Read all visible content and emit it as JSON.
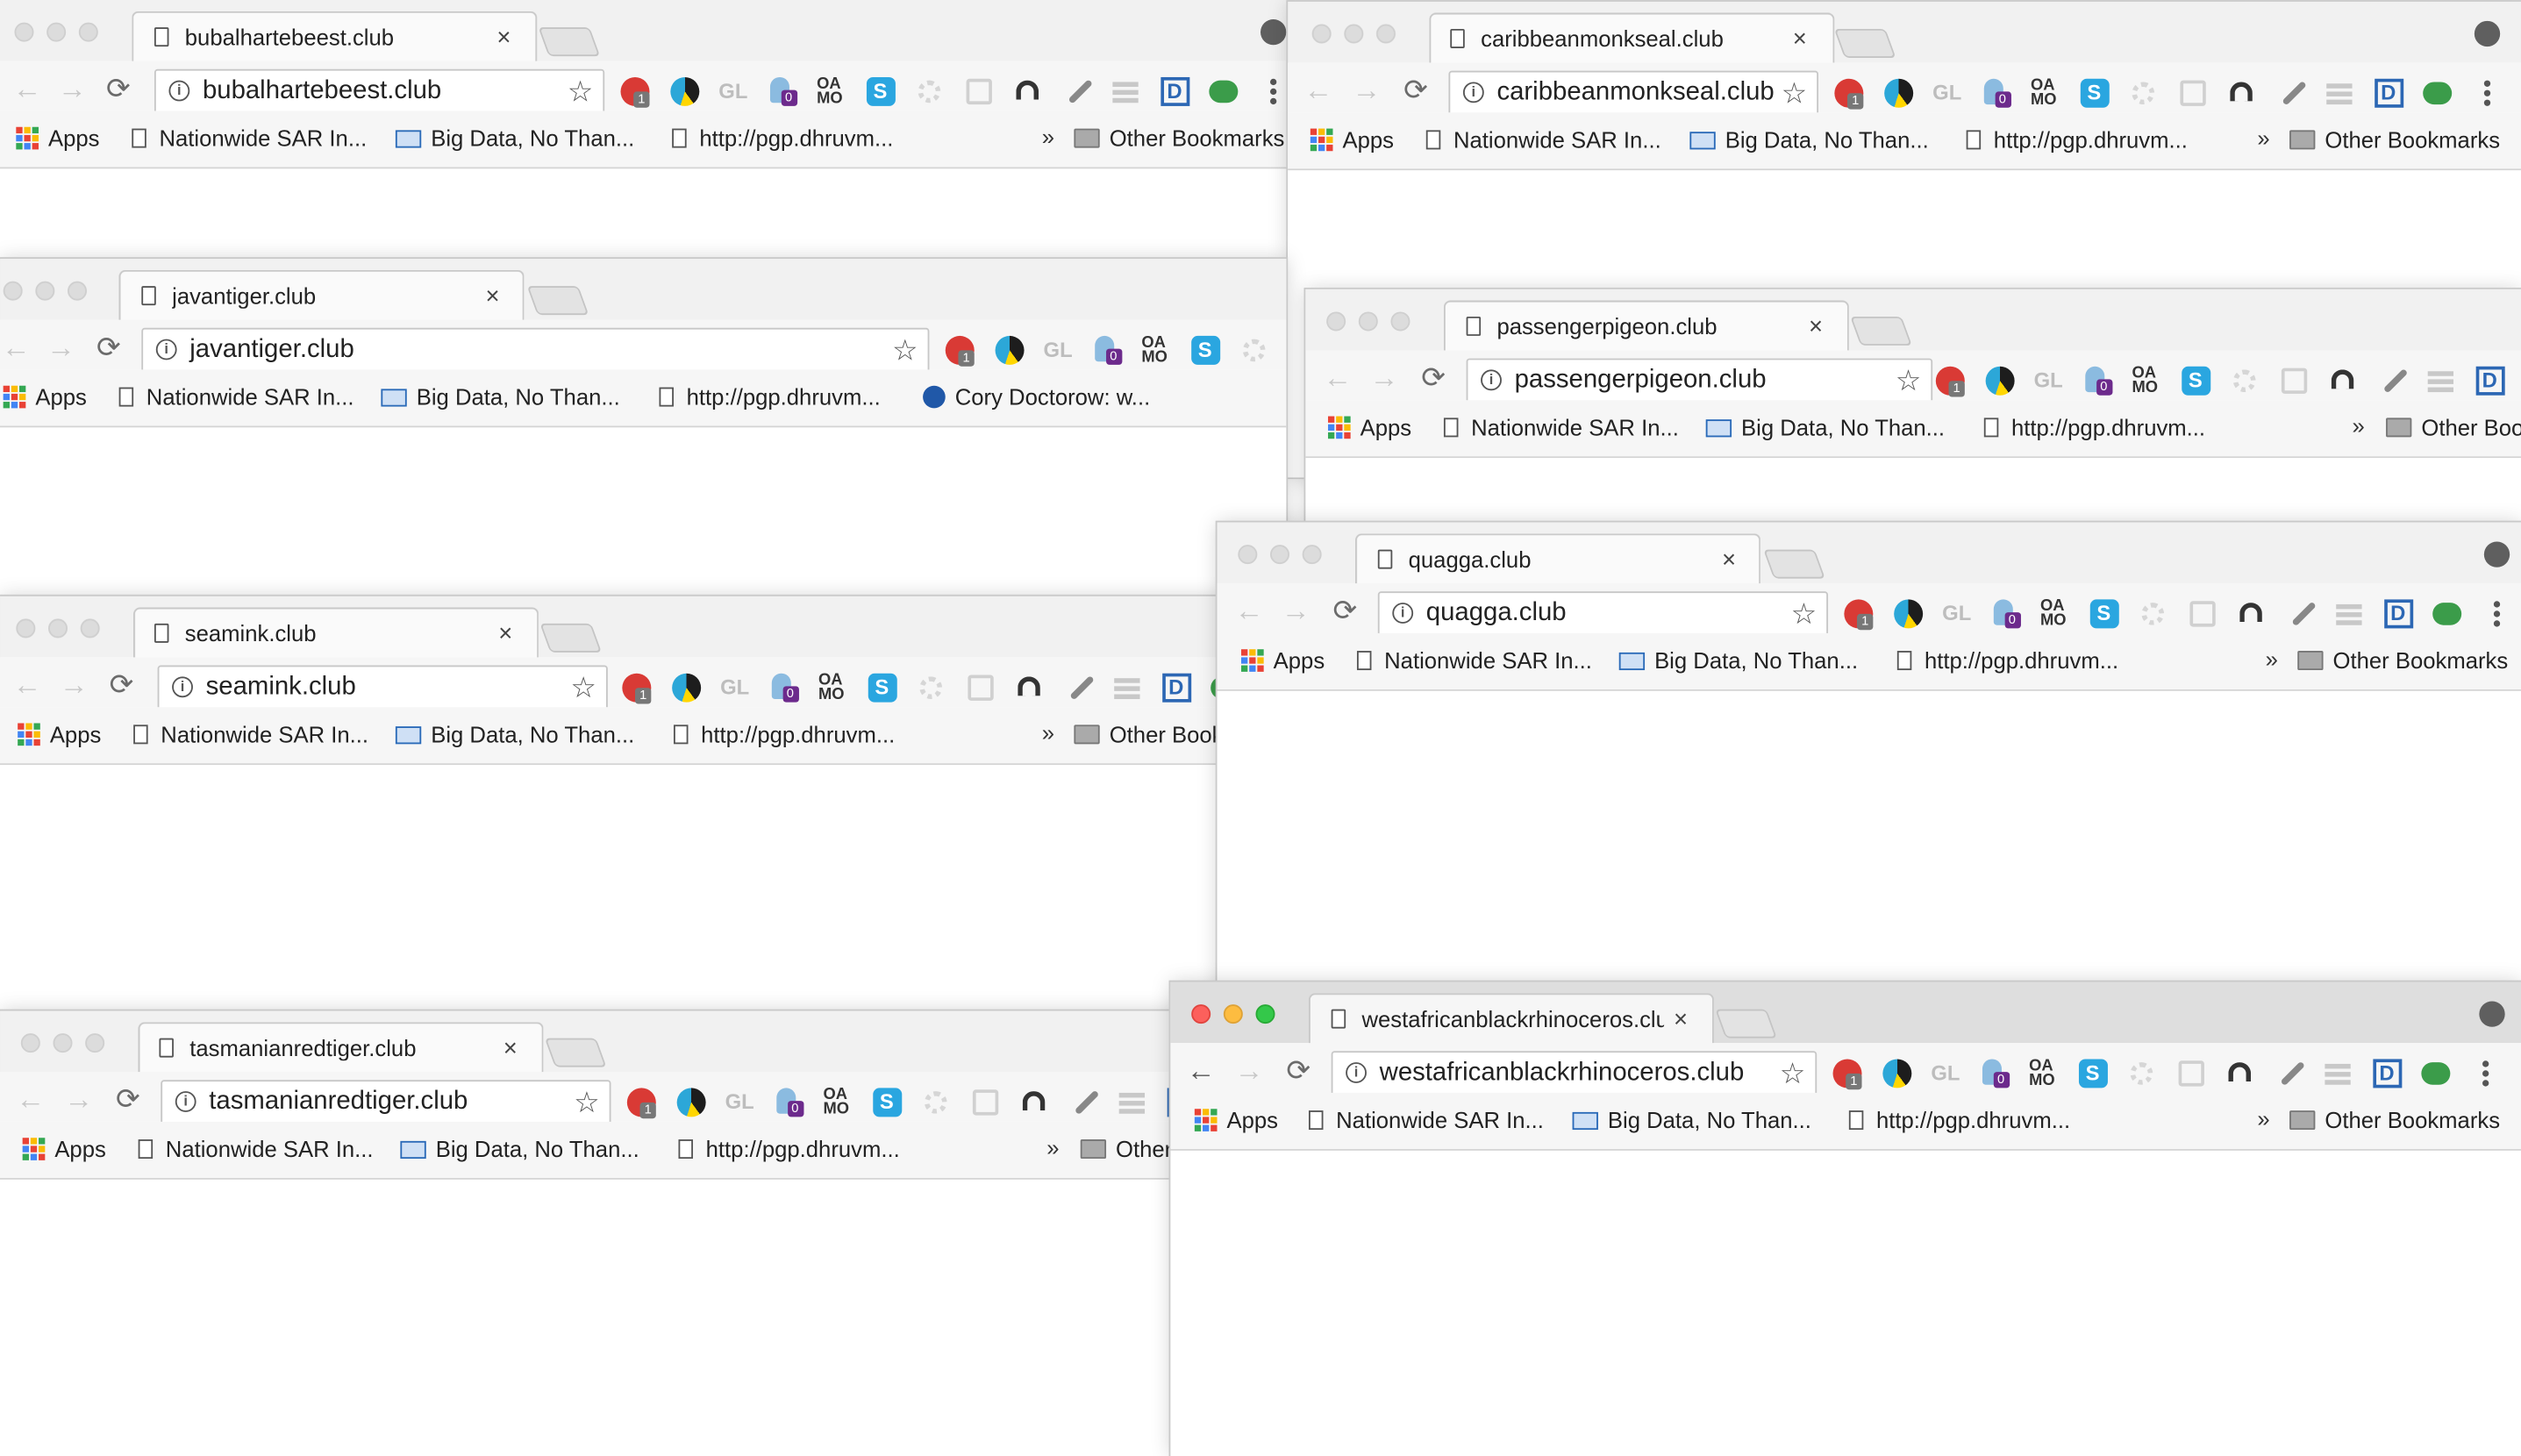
{
  "bookmarks": {
    "apps": "Apps",
    "nationwide": "Nationwide SAR In...",
    "bigdata": "Big Data, No Than...",
    "pgp": "http://pgp.dhruvm...",
    "cory": "Cory Doctorow: w...",
    "other": "Other Bookmarks",
    "chevron": "»"
  },
  "extensions": {
    "gl": "GL",
    "oamo": "OA MO",
    "abp_count": "1",
    "ghost_count": "0",
    "skype": "S",
    "dpla": "D"
  },
  "windows": [
    {
      "tab": "bubalhartebeest.club",
      "url": "bubalhartebeest.club",
      "active": false
    },
    {
      "tab": "caribbeanmonkseal.club",
      "url": "caribbeanmonkseal.club",
      "active": false
    },
    {
      "tab": "javantiger.club",
      "url": "javantiger.club",
      "active": false
    },
    {
      "tab": "passengerpigeon.club",
      "url": "passengerpigeon.club",
      "active": false
    },
    {
      "tab": "quagga.club",
      "url": "quagga.club",
      "active": false
    },
    {
      "tab": "seamink.club",
      "url": "seamink.club",
      "active": false
    },
    {
      "tab": "westafricanblackrhinoceros.club",
      "url": "westafricanblackrhinoceros.club",
      "active": true
    },
    {
      "tab": "tasmanianredtiger.club",
      "url": "tasmanianredtiger.club",
      "active": false
    }
  ],
  "colors": {
    "apps": [
      "#e94235",
      "#fbbc04",
      "#34a853",
      "#4285f4",
      "#e94235",
      "#fbbc04",
      "#34a853",
      "#4285f4",
      "#e94235"
    ],
    "abp": "#d93a35",
    "ghost_badge": "#6c2a8c",
    "skype": "#2aa6e0",
    "dpla": "#2c67b4",
    "frog": "#3b9c4a"
  }
}
